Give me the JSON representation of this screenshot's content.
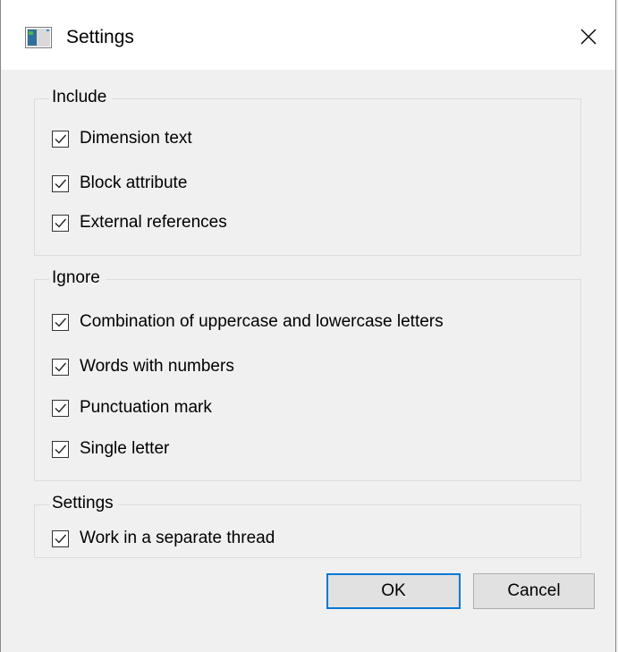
{
  "window": {
    "title": "Settings",
    "app_icon": "window-app-icon",
    "close_icon": "close-icon"
  },
  "groups": [
    {
      "label": "Include",
      "items": [
        {
          "label": "Dimension text",
          "checked": true
        },
        {
          "label": "Block attribute",
          "checked": true
        },
        {
          "label": "External references",
          "checked": true
        }
      ]
    },
    {
      "label": "Ignore",
      "items": [
        {
          "label": "Combination of uppercase and lowercase letters",
          "checked": true
        },
        {
          "label": "Words with numbers",
          "checked": true
        },
        {
          "label": "Punctuation mark",
          "checked": true
        },
        {
          "label": "Single letter",
          "checked": true
        }
      ]
    },
    {
      "label": "Settings",
      "items": [
        {
          "label": "Work in a separate thread",
          "checked": true
        }
      ]
    }
  ],
  "buttons": {
    "ok_label": "OK",
    "cancel_label": "Cancel"
  },
  "colors": {
    "accent": "#0078d7",
    "background": "#f0f0f0"
  }
}
